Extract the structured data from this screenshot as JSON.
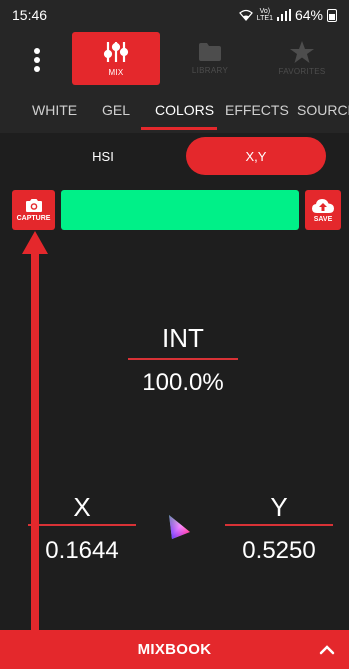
{
  "status": {
    "time": "15:46",
    "lte": "Vo))\nLTE1",
    "battery": "64%"
  },
  "nav": {
    "mix_label": "MIX",
    "library_label": "LIBRARY",
    "favorites_label": "FAVORITES"
  },
  "tabs": [
    {
      "label": "WHITE"
    },
    {
      "label": "GEL"
    },
    {
      "label": "COLORS",
      "active": true
    },
    {
      "label": "EFFECTS"
    },
    {
      "label": "SOURCE"
    }
  ],
  "modes": {
    "hsi": "HSI",
    "xy": "X,Y",
    "selected": "X,Y"
  },
  "capture_label": "CAPTURE",
  "save_label": "SAVE",
  "swatch_color": "#00f088",
  "intensity": {
    "label": "INT",
    "value": "100.0%"
  },
  "x": {
    "label": "X",
    "value": "0.1644"
  },
  "y": {
    "label": "Y",
    "value": "0.5250"
  },
  "bottom": {
    "label": "MIXBOOK"
  },
  "colors": {
    "accent": "#e4282c",
    "background": "#1e1e1e",
    "bar": "#262626"
  }
}
